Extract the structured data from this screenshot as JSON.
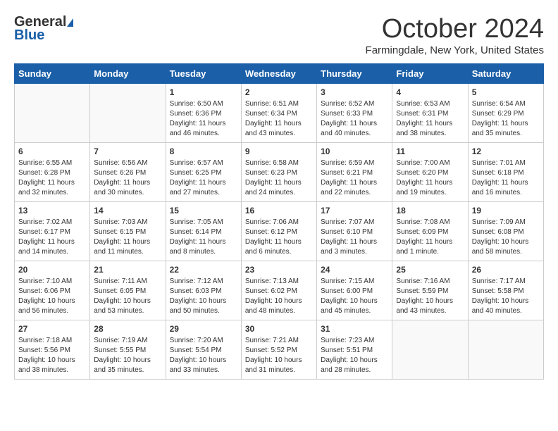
{
  "header": {
    "logo_general": "General",
    "logo_blue": "Blue",
    "title": "October 2024",
    "subtitle": "Farmingdale, New York, United States"
  },
  "weekdays": [
    "Sunday",
    "Monday",
    "Tuesday",
    "Wednesday",
    "Thursday",
    "Friday",
    "Saturday"
  ],
  "weeks": [
    [
      {
        "day": "",
        "info": ""
      },
      {
        "day": "",
        "info": ""
      },
      {
        "day": "1",
        "info": "Sunrise: 6:50 AM\nSunset: 6:36 PM\nDaylight: 11 hours and 46 minutes."
      },
      {
        "day": "2",
        "info": "Sunrise: 6:51 AM\nSunset: 6:34 PM\nDaylight: 11 hours and 43 minutes."
      },
      {
        "day": "3",
        "info": "Sunrise: 6:52 AM\nSunset: 6:33 PM\nDaylight: 11 hours and 40 minutes."
      },
      {
        "day": "4",
        "info": "Sunrise: 6:53 AM\nSunset: 6:31 PM\nDaylight: 11 hours and 38 minutes."
      },
      {
        "day": "5",
        "info": "Sunrise: 6:54 AM\nSunset: 6:29 PM\nDaylight: 11 hours and 35 minutes."
      }
    ],
    [
      {
        "day": "6",
        "info": "Sunrise: 6:55 AM\nSunset: 6:28 PM\nDaylight: 11 hours and 32 minutes."
      },
      {
        "day": "7",
        "info": "Sunrise: 6:56 AM\nSunset: 6:26 PM\nDaylight: 11 hours and 30 minutes."
      },
      {
        "day": "8",
        "info": "Sunrise: 6:57 AM\nSunset: 6:25 PM\nDaylight: 11 hours and 27 minutes."
      },
      {
        "day": "9",
        "info": "Sunrise: 6:58 AM\nSunset: 6:23 PM\nDaylight: 11 hours and 24 minutes."
      },
      {
        "day": "10",
        "info": "Sunrise: 6:59 AM\nSunset: 6:21 PM\nDaylight: 11 hours and 22 minutes."
      },
      {
        "day": "11",
        "info": "Sunrise: 7:00 AM\nSunset: 6:20 PM\nDaylight: 11 hours and 19 minutes."
      },
      {
        "day": "12",
        "info": "Sunrise: 7:01 AM\nSunset: 6:18 PM\nDaylight: 11 hours and 16 minutes."
      }
    ],
    [
      {
        "day": "13",
        "info": "Sunrise: 7:02 AM\nSunset: 6:17 PM\nDaylight: 11 hours and 14 minutes."
      },
      {
        "day": "14",
        "info": "Sunrise: 7:03 AM\nSunset: 6:15 PM\nDaylight: 11 hours and 11 minutes."
      },
      {
        "day": "15",
        "info": "Sunrise: 7:05 AM\nSunset: 6:14 PM\nDaylight: 11 hours and 8 minutes."
      },
      {
        "day": "16",
        "info": "Sunrise: 7:06 AM\nSunset: 6:12 PM\nDaylight: 11 hours and 6 minutes."
      },
      {
        "day": "17",
        "info": "Sunrise: 7:07 AM\nSunset: 6:10 PM\nDaylight: 11 hours and 3 minutes."
      },
      {
        "day": "18",
        "info": "Sunrise: 7:08 AM\nSunset: 6:09 PM\nDaylight: 11 hours and 1 minute."
      },
      {
        "day": "19",
        "info": "Sunrise: 7:09 AM\nSunset: 6:08 PM\nDaylight: 10 hours and 58 minutes."
      }
    ],
    [
      {
        "day": "20",
        "info": "Sunrise: 7:10 AM\nSunset: 6:06 PM\nDaylight: 10 hours and 56 minutes."
      },
      {
        "day": "21",
        "info": "Sunrise: 7:11 AM\nSunset: 6:05 PM\nDaylight: 10 hours and 53 minutes."
      },
      {
        "day": "22",
        "info": "Sunrise: 7:12 AM\nSunset: 6:03 PM\nDaylight: 10 hours and 50 minutes."
      },
      {
        "day": "23",
        "info": "Sunrise: 7:13 AM\nSunset: 6:02 PM\nDaylight: 10 hours and 48 minutes."
      },
      {
        "day": "24",
        "info": "Sunrise: 7:15 AM\nSunset: 6:00 PM\nDaylight: 10 hours and 45 minutes."
      },
      {
        "day": "25",
        "info": "Sunrise: 7:16 AM\nSunset: 5:59 PM\nDaylight: 10 hours and 43 minutes."
      },
      {
        "day": "26",
        "info": "Sunrise: 7:17 AM\nSunset: 5:58 PM\nDaylight: 10 hours and 40 minutes."
      }
    ],
    [
      {
        "day": "27",
        "info": "Sunrise: 7:18 AM\nSunset: 5:56 PM\nDaylight: 10 hours and 38 minutes."
      },
      {
        "day": "28",
        "info": "Sunrise: 7:19 AM\nSunset: 5:55 PM\nDaylight: 10 hours and 35 minutes."
      },
      {
        "day": "29",
        "info": "Sunrise: 7:20 AM\nSunset: 5:54 PM\nDaylight: 10 hours and 33 minutes."
      },
      {
        "day": "30",
        "info": "Sunrise: 7:21 AM\nSunset: 5:52 PM\nDaylight: 10 hours and 31 minutes."
      },
      {
        "day": "31",
        "info": "Sunrise: 7:23 AM\nSunset: 5:51 PM\nDaylight: 10 hours and 28 minutes."
      },
      {
        "day": "",
        "info": ""
      },
      {
        "day": "",
        "info": ""
      }
    ]
  ]
}
